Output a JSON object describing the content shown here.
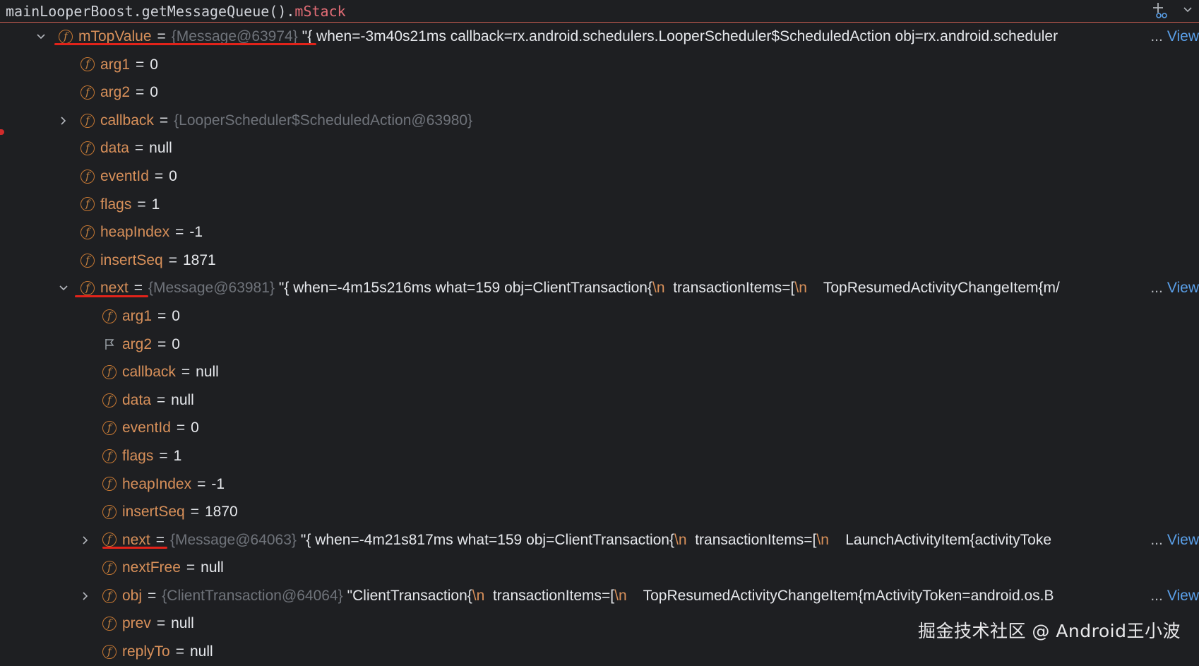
{
  "header": {
    "expression_main": "mainLooperBoost.getMessageQueue().",
    "expression_field": "mStack"
  },
  "rows": [
    {
      "name": "mTopValue",
      "ref": "{Message@63974}",
      "value": "\"{ when=-3m40s21ms callback=rx.android.schedulers.LooperScheduler$ScheduledAction obj=rx.android.scheduler",
      "view": "View"
    },
    {
      "name": "arg1",
      "value": "0"
    },
    {
      "name": "arg2",
      "value": "0"
    },
    {
      "name": "callback",
      "ref": "{LooperScheduler$ScheduledAction@63980}"
    },
    {
      "name": "data",
      "value": "null"
    },
    {
      "name": "eventId",
      "value": "0"
    },
    {
      "name": "flags",
      "value": "1"
    },
    {
      "name": "heapIndex",
      "value": "-1"
    },
    {
      "name": "insertSeq",
      "value": "1871"
    },
    {
      "name": "next",
      "ref": "{Message@63981}",
      "value_parts": [
        "\"{ when=-4m15s216ms what=159 obj=ClientTransaction{",
        "\\n",
        "  transactionItems=[",
        "\\n",
        "    TopResumedActivityChangeItem{m/"
      ],
      "view": "View"
    },
    {
      "name": "arg1",
      "value": "0"
    },
    {
      "name": "arg2",
      "value": "0"
    },
    {
      "name": "callback",
      "value": "null"
    },
    {
      "name": "data",
      "value": "null"
    },
    {
      "name": "eventId",
      "value": "0"
    },
    {
      "name": "flags",
      "value": "1"
    },
    {
      "name": "heapIndex",
      "value": "-1"
    },
    {
      "name": "insertSeq",
      "value": "1870"
    },
    {
      "name": "next",
      "ref": "{Message@64063}",
      "value_parts": [
        "\"{ when=-4m21s817ms what=159 obj=ClientTransaction{",
        "\\n",
        "  transactionItems=[",
        "\\n",
        "    LaunchActivityItem{activityToke"
      ],
      "view": "View"
    },
    {
      "name": "nextFree",
      "value": "null"
    },
    {
      "name": "obj",
      "ref": "{ClientTransaction@64064}",
      "value_parts": [
        "\"ClientTransaction{",
        "\\n",
        "  transactionItems=[",
        "\\n",
        "    TopResumedActivityChangeItem{mActivityToken=android.os.B"
      ],
      "view": "View"
    },
    {
      "name": "prev",
      "value": "null"
    },
    {
      "name": "replyTo",
      "value": "null"
    }
  ],
  "ellipsis": "...",
  "field_icon_letter": "f",
  "equals": "=",
  "watermark": "掘金技术社区 @ Android王小波",
  "colors": {
    "background": "#1e1f22",
    "field_name": "#d8905a",
    "reference": "#6f737a",
    "link": "#5a9fe8",
    "highlight_underline": "#e2231a",
    "header_accent": "#e06c75"
  },
  "icons": [
    "chevron-down-icon",
    "chevron-right-icon",
    "field-icon",
    "flag-icon",
    "add-watch-icon",
    "dropdown-icon"
  ]
}
